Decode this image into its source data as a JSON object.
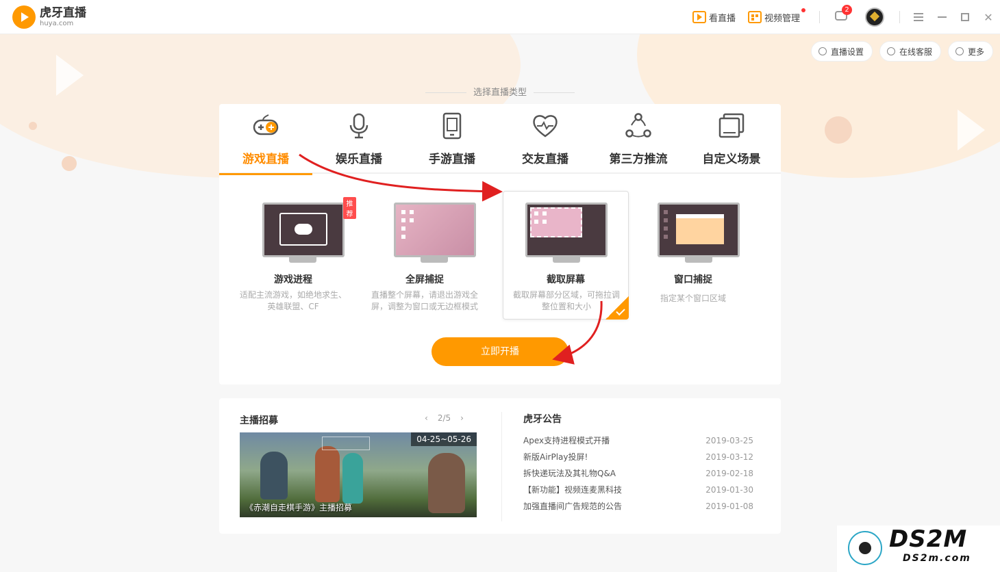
{
  "app": {
    "name_cn": "虎牙直播",
    "name_en": "huya.com"
  },
  "titlebar": {
    "watch_live": "看直播",
    "video_manage": "视频管理",
    "message_count": "2"
  },
  "pills": {
    "live_settings": "直播设置",
    "online_service": "在线客服",
    "more": "更多"
  },
  "section_title": "选择直播类型",
  "tabs": [
    {
      "label": "游戏直播",
      "icon": "gamepad-icon",
      "active": true
    },
    {
      "label": "娱乐直播",
      "icon": "microphone-icon",
      "active": false
    },
    {
      "label": "手游直播",
      "icon": "phone-icon",
      "active": false
    },
    {
      "label": "交友直播",
      "icon": "heart-pulse-icon",
      "active": false
    },
    {
      "label": "第三方推流",
      "icon": "share-nodes-icon",
      "active": false
    },
    {
      "label": "自定义场景",
      "icon": "window-stack-icon",
      "active": false
    }
  ],
  "options": [
    {
      "title": "游戏进程",
      "desc": "适配主流游戏，如绝地求生、英雄联盟、CF",
      "tag": "推荐"
    },
    {
      "title": "全屏捕捉",
      "desc": "直播整个屏幕，请退出游戏全屏，调整为窗口或无边框模式"
    },
    {
      "title": "截取屏幕",
      "desc": "截取屏幕部分区域，可拖拉调整位置和大小",
      "selected": true
    },
    {
      "title": "窗口捕捉",
      "desc": "指定某个窗口区域"
    }
  ],
  "start_button": "立即开播",
  "recruit": {
    "title": "主播招募",
    "pager": "2/5",
    "date_range": "04-25~05-26",
    "caption": "《赤潮自走棋手游》主播招募"
  },
  "notices": {
    "title": "虎牙公告",
    "items": [
      {
        "text": "Apex支持进程模式开播",
        "date": "2019-03-25"
      },
      {
        "text": "新版AirPlay投屏!",
        "date": "2019-03-12"
      },
      {
        "text": "拆快递玩法及其礼物Q&A",
        "date": "2019-02-18"
      },
      {
        "text": "【新功能】视频连麦黑科技",
        "date": "2019-01-30"
      },
      {
        "text": "加强直播间广告规范的公告",
        "date": "2019-01-08"
      }
    ]
  },
  "watermark": {
    "big": "DS2M",
    "small": "DS2m.com"
  },
  "colors": {
    "accent": "#ff9900",
    "active_text": "#ff8c00",
    "arrow": "#e02020"
  }
}
